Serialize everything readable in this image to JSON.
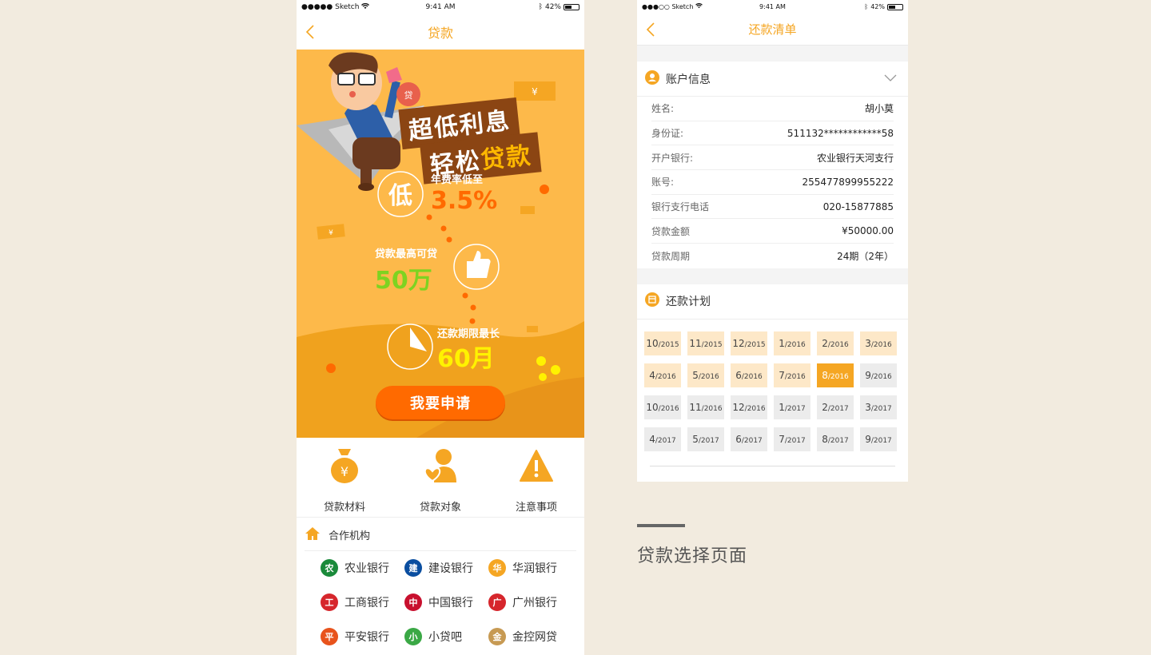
{
  "left_phone": {
    "status": {
      "carrier": "●●●●● Sketch",
      "time": "9:41 AM",
      "battery": "42%"
    },
    "nav_title": "贷款",
    "hero": {
      "slogan_line1_a": "超低",
      "slogan_line1_b": "利息",
      "slogan_line2_a": "轻松",
      "slogan_line2_b": "贷款",
      "badge_low": "低",
      "feature1_label": "年费率低至",
      "feature1_value": "3.5%",
      "feature2_label": "贷款最高可贷",
      "feature2_value": "50万",
      "feature3_label": "还款期限最长",
      "feature3_value": "60月",
      "apply_button": "我要申请",
      "money_badge": "贷",
      "yen": "¥"
    },
    "quick_links": [
      {
        "label": "贷款材料",
        "icon": "money-bag-icon"
      },
      {
        "label": "贷款对象",
        "icon": "people-heart-icon"
      },
      {
        "label": "注意事项",
        "icon": "warning-icon"
      }
    ],
    "partners_title": "合作机构",
    "banks": [
      {
        "name": "农业银行",
        "color": "#1a8a3a",
        "mark": "农"
      },
      {
        "name": "建设银行",
        "color": "#0a4ea0",
        "mark": "建"
      },
      {
        "name": "华润银行",
        "color": "#f5a623",
        "mark": "华"
      },
      {
        "name": "工商银行",
        "color": "#d6262c",
        "mark": "工"
      },
      {
        "name": "中国银行",
        "color": "#c8102e",
        "mark": "中"
      },
      {
        "name": "广州银行",
        "color": "#d6262c",
        "mark": "广"
      },
      {
        "name": "平安银行",
        "color": "#e8531c",
        "mark": "平"
      },
      {
        "name": "小贷吧",
        "color": "#3aa845",
        "mark": "小"
      },
      {
        "name": "金控网贷",
        "color": "#c79a53",
        "mark": "金"
      }
    ]
  },
  "right_phone": {
    "status": {
      "carrier": "●●●○○ Sketch",
      "time": "9:41 AM",
      "battery": "42%"
    },
    "nav_title": "还款清单",
    "account_title": "账户信息",
    "account_rows": [
      {
        "k": "姓名:",
        "v": "胡小莫"
      },
      {
        "k": "身份证:",
        "v": "511132************58"
      },
      {
        "k": "开户银行:",
        "v": "农业银行天河支行"
      },
      {
        "k": "账号:",
        "v": "255477899955222"
      },
      {
        "k": "银行支行电话",
        "v": "020-15877885"
      },
      {
        "k": "贷款金额",
        "v": "¥50000.00"
      },
      {
        "k": "贷款周期",
        "v": "24期（2年）"
      }
    ],
    "plan_title": "还款计划",
    "months": [
      {
        "m": "10",
        "y": "/2015",
        "state": "paid"
      },
      {
        "m": "11",
        "y": "/2015",
        "state": "paid"
      },
      {
        "m": "12",
        "y": "/2015",
        "state": "paid"
      },
      {
        "m": "1",
        "y": "/2016",
        "state": "paid"
      },
      {
        "m": "2",
        "y": "/2016",
        "state": "paid"
      },
      {
        "m": "3",
        "y": "/2016",
        "state": "paid"
      },
      {
        "m": "4",
        "y": "/2016",
        "state": "paid"
      },
      {
        "m": "5",
        "y": "/2016",
        "state": "paid"
      },
      {
        "m": "6",
        "y": "/2016",
        "state": "paid"
      },
      {
        "m": "7",
        "y": "/2016",
        "state": "paid"
      },
      {
        "m": "8",
        "y": "/2016",
        "state": "current"
      },
      {
        "m": "9",
        "y": "/2016",
        "state": "future"
      },
      {
        "m": "10",
        "y": "/2016",
        "state": "future"
      },
      {
        "m": "11",
        "y": "/2016",
        "state": "future"
      },
      {
        "m": "12",
        "y": "/2016",
        "state": "future"
      },
      {
        "m": "1",
        "y": "/2017",
        "state": "future"
      },
      {
        "m": "2",
        "y": "/2017",
        "state": "future"
      },
      {
        "m": "3",
        "y": "/2017",
        "state": "future"
      },
      {
        "m": "4",
        "y": "/2017",
        "state": "future"
      },
      {
        "m": "5",
        "y": "/2017",
        "state": "future"
      },
      {
        "m": "6",
        "y": "/2017",
        "state": "future"
      },
      {
        "m": "7",
        "y": "/2017",
        "state": "future"
      },
      {
        "m": "8",
        "y": "/2017",
        "state": "future"
      },
      {
        "m": "9",
        "y": "/2017",
        "state": "future"
      }
    ]
  },
  "caption": "贷款选择页面",
  "colors": {
    "accent": "#f5a623",
    "hero_bg": "#fdb94a",
    "apply_button": "#ff6a00",
    "value_green": "#7ed321",
    "value_orange": "#ff6a00",
    "value_yellow": "#fff200"
  }
}
